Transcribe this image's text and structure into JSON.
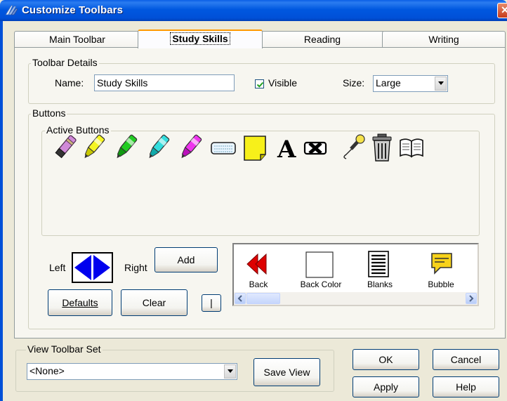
{
  "window": {
    "title": "Customize Toolbars",
    "close_label": "✕"
  },
  "tabs": [
    {
      "label": "Main Toolbar"
    },
    {
      "label": "Study Skills",
      "active": true
    },
    {
      "label": "Reading"
    },
    {
      "label": "Writing"
    }
  ],
  "toolbar_details": {
    "legend": "Toolbar Details",
    "name_label": "Name:",
    "name_value": "Study Skills",
    "visible_label": "Visible",
    "visible_checked": true,
    "size_label": "Size:",
    "size_value": "Large"
  },
  "buttons_group": {
    "legend": "Buttons",
    "active_buttons_legend": "Active Buttons",
    "active_icons": [
      "eraser-icon",
      "highlighter-yellow-icon",
      "highlighter-green-icon",
      "highlighter-cyan-icon",
      "highlighter-magenta-icon",
      "collect-highlights-icon",
      "sticky-note-icon",
      "text-note-icon",
      "clear-highlights-icon",
      "microphone-icon",
      "trash-icon",
      "open-book-icon"
    ],
    "left_label": "Left",
    "right_label": "Right",
    "add_label": "Add",
    "defaults_label": "Defaults",
    "clear_label": "Clear",
    "separator_label": "|",
    "available": [
      {
        "label": "Back",
        "icon": "back-arrow-icon"
      },
      {
        "label": "Back Color",
        "icon": "back-color-icon"
      },
      {
        "label": "Blanks",
        "icon": "blanks-icon"
      },
      {
        "label": "Bubble",
        "icon": "bubble-icon"
      }
    ],
    "scroll_left": "<",
    "scroll_right": ">"
  },
  "view_toolbar_set": {
    "legend": "View Toolbar Set",
    "selected": "<None>",
    "save_view_label": "Save View"
  },
  "footer": {
    "ok_label": "OK",
    "cancel_label": "Cancel",
    "apply_label": "Apply",
    "help_label": "Help"
  },
  "colors": {
    "accent": "#0058e0",
    "tab_active_border": "#ff9900",
    "dialog_bg": "#ece9d8"
  }
}
